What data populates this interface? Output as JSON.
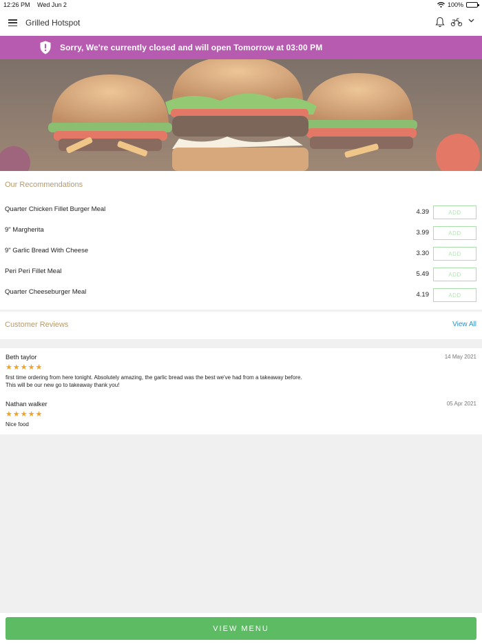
{
  "status_bar": {
    "time": "12:26 PM",
    "date": "Wed Jun 2",
    "battery": "100%"
  },
  "header": {
    "title": "Grilled Hotspot"
  },
  "banner": {
    "message": "Sorry, We're currently closed and will open Tomorrow at 03:00 PM",
    "color": "#b75bb1"
  },
  "recommendations": {
    "title": "Our Recommendations",
    "items": [
      {
        "name": "Quarter Chicken Fillet Burger Meal",
        "price": "4.39",
        "button": "ADD"
      },
      {
        "name": "9\" Margherita",
        "price": "3.99",
        "button": "ADD"
      },
      {
        "name": "9\" Garlic Bread With Cheese",
        "price": "3.30",
        "button": "ADD"
      },
      {
        "name": "Peri Peri Fillet Meal",
        "price": "5.49",
        "button": "ADD"
      },
      {
        "name": "Quarter Cheeseburger Meal",
        "price": "4.19",
        "button": "ADD"
      }
    ]
  },
  "reviews": {
    "title": "Customer Reviews",
    "view_all": "View All",
    "items": [
      {
        "author": "Beth taylor",
        "date": "14 May 2021",
        "stars": "★★★★★",
        "rating": 5,
        "text_line1": "first time ordering from here tonight. Absolutely amazing, the garlic bread was the best we've had from a takeaway before.",
        "text_line2": "This will be our new go to takeaway thank you!"
      },
      {
        "author": "Nathan walker",
        "date": "05 Apr 2021",
        "stars": "★★★★★",
        "rating": 5,
        "text_line1": "Nice food",
        "text_line2": ""
      }
    ]
  },
  "footer": {
    "button": "VIEW MENU",
    "color": "#5cbb63"
  },
  "icons": [
    "menu-icon",
    "bell-icon",
    "scooter-icon",
    "chevron-down-icon",
    "shield-alert-icon",
    "wifi-icon",
    "battery-icon"
  ]
}
